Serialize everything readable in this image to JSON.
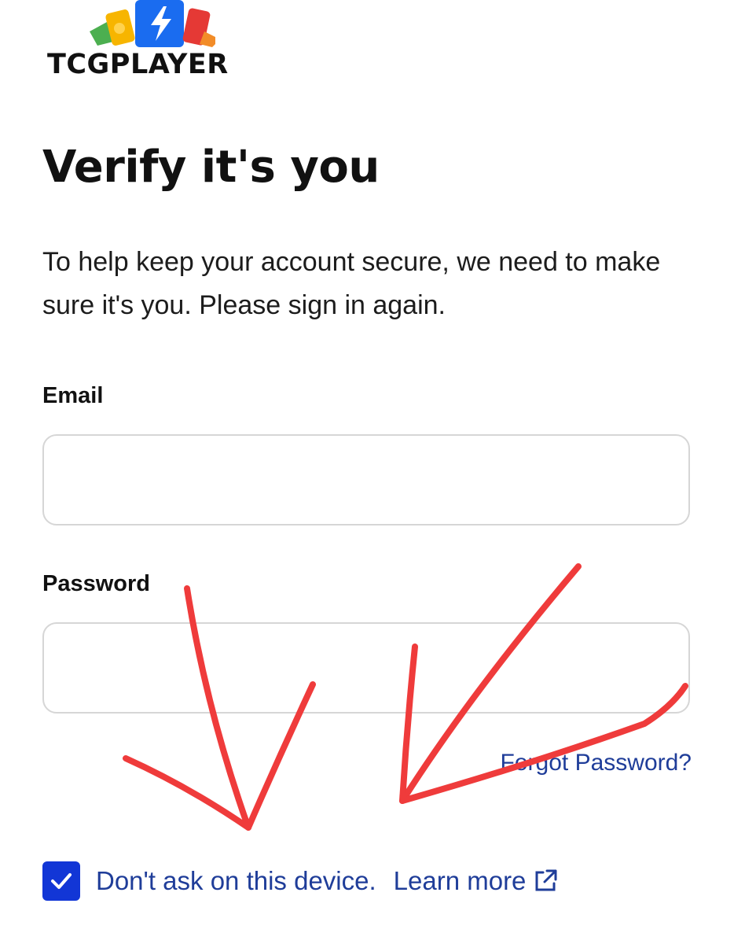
{
  "brand": {
    "name": "TCGPLAYER",
    "card_colors": [
      "#4caf50",
      "#f7b500",
      "#1a6cf0",
      "#e53935",
      "#f28c28"
    ]
  },
  "page": {
    "title": "Verify it's you",
    "description": "To help keep your account secure, we need to make sure it's you. Please sign in again."
  },
  "form": {
    "email_label": "Email",
    "email_value": "",
    "password_label": "Password",
    "password_value": "",
    "forgot_password": "Forgot Password?",
    "remember_checked": true,
    "remember_label": "Don't ask on this device.",
    "learn_more": "Learn more"
  },
  "colors": {
    "link": "#1f3d99",
    "checkbox": "#1236d6",
    "annotation": "#ef3b3b"
  },
  "icons": {
    "checkbox": "check-icon",
    "learn_more": "external-link-icon"
  }
}
